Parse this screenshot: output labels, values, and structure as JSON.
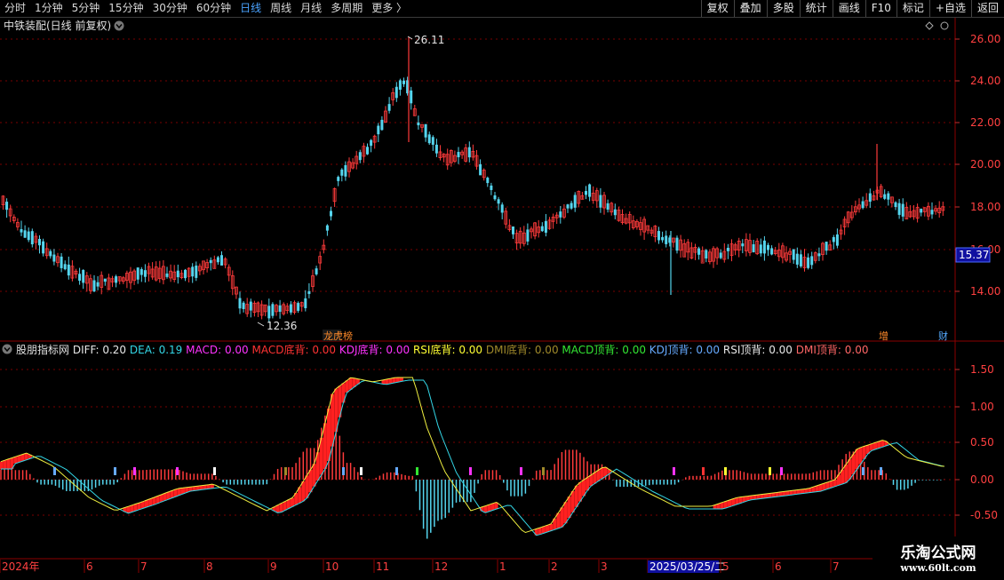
{
  "toolbar": {
    "periods": [
      "分时",
      "1分钟",
      "5分钟",
      "15分钟",
      "30分钟",
      "60分钟",
      "日线",
      "周线",
      "月线",
      "多周期",
      "更多 〉"
    ],
    "active_period": "日线",
    "buttons": [
      "复权",
      "叠加",
      "多股",
      "统计",
      "画线",
      "F10",
      "标记",
      "+自选",
      "返回"
    ]
  },
  "main_chart": {
    "title": "中铁装配(日线 前复权)",
    "price_axis": [
      "26.00",
      "24.00",
      "22.00",
      "20.00",
      "18.00",
      "16.00",
      "14.00"
    ],
    "high_label": "26.11",
    "low_label": "12.36",
    "current_price": "15.37",
    "markers": {
      "lhb": "龙虎榜",
      "zeng": "增",
      "cai": "财"
    }
  },
  "indicator": {
    "name": "股朋指标网",
    "fields": [
      {
        "label": "DIFF: ",
        "value": "0.20",
        "color": "#e8e8e8"
      },
      {
        "label": "DEA: ",
        "value": "0.19",
        "color": "#33d6e6"
      },
      {
        "label": "MACD: ",
        "value": "0.00",
        "color": "#ff33ff"
      },
      {
        "label": "MACD底背: ",
        "value": "0.00",
        "color": "#ff3333"
      },
      {
        "label": "KDJ底背: ",
        "value": "0.00",
        "color": "#ff33ff"
      },
      {
        "label": "RSI底背: ",
        "value": "0.00",
        "color": "#ffff33"
      },
      {
        "label": "DMI底背: ",
        "value": "0.00",
        "color": "#a08a2a"
      },
      {
        "label": "MACD顶背: ",
        "value": "0.00",
        "color": "#33e633"
      },
      {
        "label": "KDJ顶背: ",
        "value": "0.00",
        "color": "#66aaff"
      },
      {
        "label": "RSI顶背: ",
        "value": "0.00",
        "color": "#e8e8e8"
      },
      {
        "label": "DMI顶背: ",
        "value": "0.00",
        "color": "#ff6666"
      }
    ],
    "axis": [
      "1.50",
      "1.00",
      "0.50",
      "0.00",
      "-0.50"
    ]
  },
  "time_axis": [
    "2024年",
    "6",
    "7",
    "8",
    "9",
    "10",
    "11",
    "12",
    "1",
    "2",
    "3",
    "2025/03/25/二",
    "5",
    "6",
    "7"
  ],
  "watermark": {
    "line1": "乐淘公式网",
    "line2": "www.60lt.com"
  },
  "colors": {
    "up": "#ff3b3b",
    "down": "#55d5ee",
    "grid": "#8b0000",
    "axis_text": "#ff4040",
    "price_box": "#1010a0"
  }
}
